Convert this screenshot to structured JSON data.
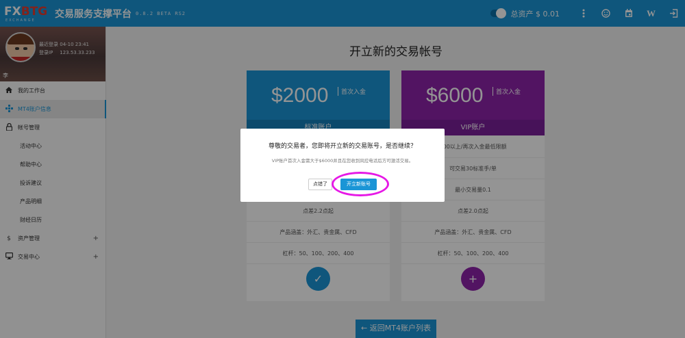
{
  "topbar": {
    "logo_text_a": "FX",
    "logo_text_b": "BTG",
    "logo_sub": "EXCHANGE",
    "title": "交易服务支撑平台",
    "version": "0.8.2 BETA RS2",
    "total_assets": "总资产 $ 0.01",
    "icons": [
      "toggle-icon",
      "more-vert-icon",
      "smiley-icon",
      "calendar-icon",
      "w-icon",
      "logout-icon"
    ]
  },
  "profile": {
    "last_login_label": "最近登录",
    "last_login_value": "04-10 23:41",
    "ip_label": "登录IP",
    "ip_value": "123.53.33.233",
    "user_name": "李"
  },
  "sidebar": {
    "items": [
      {
        "label": "我的工作台",
        "icon": "home-icon"
      },
      {
        "label": "MT4账户信息",
        "icon": "cross-move-icon",
        "active": true
      },
      {
        "label": "帐号管理",
        "icon": "lock-icon"
      },
      {
        "label": "活动中心"
      },
      {
        "label": "帮助中心"
      },
      {
        "label": "投诉建议"
      },
      {
        "label": "产品明细"
      },
      {
        "label": "财经日历"
      },
      {
        "label": "资产管理",
        "icon": "dollar-icon",
        "expand": "+"
      },
      {
        "label": "交易中心",
        "icon": "monitor-icon",
        "expand": "+"
      }
    ]
  },
  "main": {
    "title": "开立新的交易帐号",
    "back_button": "← 返回MT4账户列表"
  },
  "cards": {
    "standard": {
      "price": "$2000",
      "deposit_label": "首次入金",
      "type": "标准账户",
      "features": [
        "",
        "",
        "",
        "点差2.2点起",
        "产品涵盖：外汇、贵金属、CFD",
        "杠杆：50、100、200、400"
      ],
      "action_icon": "check-icon",
      "action_glyph": "✓"
    },
    "vip": {
      "price": "$6000",
      "deposit_label": "首次入金",
      "type": "VIP账户",
      "features": [
        "000以上/再次入金最低限额",
        "可交易30标准手/单",
        "最小交易量0.1",
        "点差2.0点起",
        "产品涵盖：外汇、贵金属、CFD",
        "杠杆：50、100、200、400"
      ],
      "action_icon": "plus-icon",
      "action_glyph": "+"
    }
  },
  "dialog": {
    "title": "尊敬的交易者，您即将开立新的交易账号，是否继续？",
    "message": "VIP账户首次入金需大于$6000并且在您收到风控电话后方可激活交易。",
    "cancel_label": "点错了",
    "ok_label": "开立新账号"
  },
  "colors": {
    "primary": "#1a95d6",
    "vip": "#8e24aa",
    "highlight": "#e619e6"
  }
}
